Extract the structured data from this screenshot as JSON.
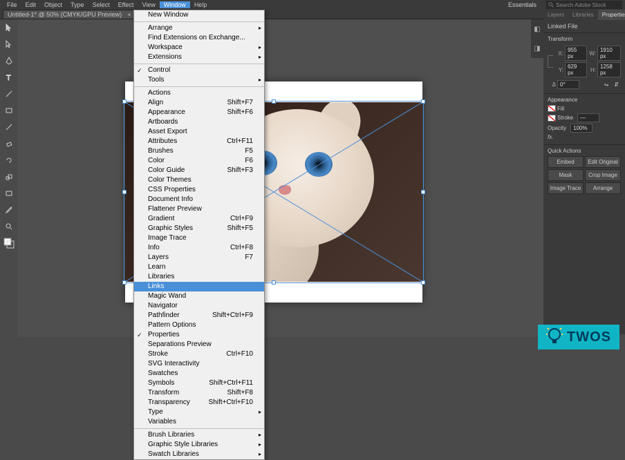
{
  "menubar": [
    "File",
    "Edit",
    "Object",
    "Type",
    "Select",
    "Effect",
    "View",
    "Window",
    "Help"
  ],
  "menubar_active_index": 7,
  "doc_tab": "Untitled-1* @ 50% (CMYK/GPU Preview)",
  "workspace_switcher": "Essentials",
  "search_placeholder": "Search Adobe Stock",
  "window_menu": {
    "top": "New Window",
    "groups": [
      [
        {
          "label": "Arrange",
          "sub": true
        },
        {
          "label": "Find Extensions on Exchange..."
        },
        {
          "label": "Workspace",
          "sub": true
        },
        {
          "label": "Extensions",
          "sub": true
        }
      ],
      [
        {
          "label": "Control",
          "checked": true
        },
        {
          "label": "Tools",
          "sub": true
        }
      ],
      [
        {
          "label": "Actions"
        },
        {
          "label": "Align",
          "shortcut": "Shift+F7"
        },
        {
          "label": "Appearance",
          "shortcut": "Shift+F6"
        },
        {
          "label": "Artboards"
        },
        {
          "label": "Asset Export"
        },
        {
          "label": "Attributes",
          "shortcut": "Ctrl+F11"
        },
        {
          "label": "Brushes",
          "shortcut": "F5"
        },
        {
          "label": "Color",
          "shortcut": "F6"
        },
        {
          "label": "Color Guide",
          "shortcut": "Shift+F3"
        },
        {
          "label": "Color Themes"
        },
        {
          "label": "CSS Properties"
        },
        {
          "label": "Document Info"
        },
        {
          "label": "Flattener Preview"
        },
        {
          "label": "Gradient",
          "shortcut": "Ctrl+F9"
        },
        {
          "label": "Graphic Styles",
          "shortcut": "Shift+F5"
        },
        {
          "label": "Image Trace"
        },
        {
          "label": "Info",
          "shortcut": "Ctrl+F8"
        },
        {
          "label": "Layers",
          "shortcut": "F7"
        },
        {
          "label": "Learn"
        },
        {
          "label": "Libraries"
        },
        {
          "label": "Links",
          "selected": true
        },
        {
          "label": "Magic Wand"
        },
        {
          "label": "Navigator"
        },
        {
          "label": "Pathfinder",
          "shortcut": "Shift+Ctrl+F9"
        },
        {
          "label": "Pattern Options"
        },
        {
          "label": "Properties",
          "checked": true
        },
        {
          "label": "Separations Preview"
        },
        {
          "label": "Stroke",
          "shortcut": "Ctrl+F10"
        },
        {
          "label": "SVG Interactivity"
        },
        {
          "label": "Swatches"
        },
        {
          "label": "Symbols",
          "shortcut": "Shift+Ctrl+F11"
        },
        {
          "label": "Transform",
          "shortcut": "Shift+F8"
        },
        {
          "label": "Transparency",
          "shortcut": "Shift+Ctrl+F10"
        },
        {
          "label": "Type",
          "sub": true
        },
        {
          "label": "Variables"
        }
      ],
      [
        {
          "label": "Brush Libraries",
          "sub": true
        },
        {
          "label": "Graphic Style Libraries",
          "sub": true
        },
        {
          "label": "Swatch Libraries",
          "sub": true
        }
      ]
    ]
  },
  "properties": {
    "tabs": [
      "Layers",
      "Libraries",
      "Properties"
    ],
    "active_tab": 2,
    "header": "Linked File",
    "transform": {
      "heading": "Transform",
      "x_label": "X:",
      "x_value": "955 px",
      "y_label": "Y:",
      "y_value": "629 px",
      "w_label": "W:",
      "w_value": "1910 px",
      "h_label": "H:",
      "h_value": "1258 px",
      "angle_label": "Δ",
      "angle_value": "0°"
    },
    "appearance": {
      "heading": "Appearance",
      "fill_label": "Fill",
      "stroke_label": "Stroke",
      "opacity_label": "Opacity",
      "opacity_value": "100%",
      "fx_label": "fx."
    },
    "quick_actions": {
      "heading": "Quick Actions",
      "buttons": [
        "Embed",
        "Edit Original",
        "Mask",
        "Crop Image",
        "Image Trace",
        "Arrange"
      ]
    }
  },
  "watermark_text": "TWOS"
}
